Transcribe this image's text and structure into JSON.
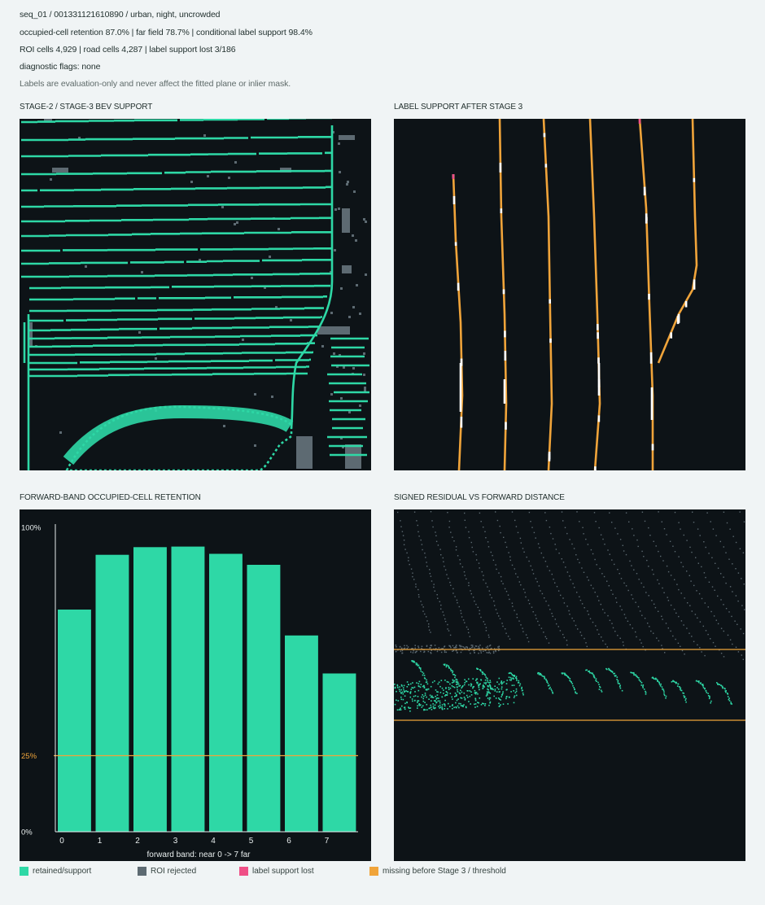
{
  "header": {
    "line1": "seq_01 / 001331121610890 / urban, night, uncrowded",
    "line2": "occupied-cell retention 87.0% | far field 78.7% | conditional label support 98.4%",
    "line3": "ROI cells 4,929 | road cells 4,287 | label support lost 3/186",
    "line4": "diagnostic flags: none",
    "note": "Labels are evaluation-only and never affect the fitted plane or inlier mask."
  },
  "panels": {
    "bev_title": "STAGE-2 / STAGE-3 BEV SUPPORT",
    "label_title": "LABEL SUPPORT AFTER STAGE 3",
    "retention_title": "FORWARD-BAND OCCUPIED-CELL RETENTION",
    "residual_title": "SIGNED RESIDUAL VS FORWARD DISTANCE"
  },
  "colors": {
    "retained": "#2ed8a6",
    "rejected": "#5d6a72",
    "lost": "#ef4f86",
    "missing": "#f0a43a",
    "panel_bg": "#0d1317"
  },
  "legend": [
    {
      "label": "retained/support",
      "color": "#2ed8a6"
    },
    {
      "label": "ROI rejected",
      "color": "#5d6a72"
    },
    {
      "label": "label support lost",
      "color": "#ef4f86"
    },
    {
      "label": "missing before Stage 3 / threshold",
      "color": "#f0a43a"
    }
  ],
  "chart_data": [
    {
      "type": "bar",
      "title": "FORWARD-BAND OCCUPIED-CELL RETENTION",
      "xlabel": "forward band: near 0 -> 7 far",
      "ylabel": "",
      "categories": [
        "0",
        "1",
        "2",
        "3",
        "4",
        "5",
        "6",
        "7"
      ],
      "values": [
        73,
        91,
        93.5,
        93.7,
        91.3,
        87.7,
        64.5,
        52
      ],
      "ylim": [
        0,
        100
      ],
      "y_tick_labels": [
        "0%",
        "25%",
        "100%"
      ],
      "threshold": {
        "value": 25,
        "label": "25%",
        "color": "#f0a43a"
      },
      "bar_color": "#2ed8a6"
    },
    {
      "type": "scatter",
      "title": "SIGNED RESIDUAL VS FORWARD DISTANCE",
      "xlabel": "",
      "ylabel": "",
      "threshold_lines": [
        "upper",
        "lower"
      ],
      "series": [
        {
          "color": "#2ed8a6"
        },
        {
          "color": "#5d6a72"
        }
      ]
    }
  ]
}
